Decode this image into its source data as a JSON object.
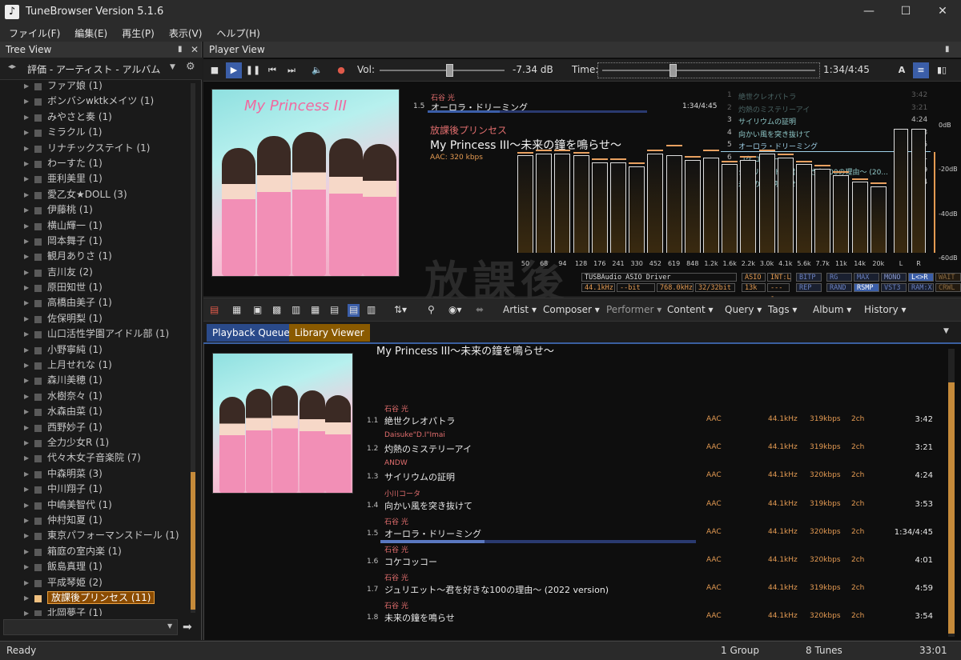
{
  "window": {
    "title": "TuneBrowser Version 5.1.6",
    "controls": [
      "—",
      "☐",
      "✕"
    ]
  },
  "menu": [
    "ファイル(F)",
    "編集(E)",
    "再生(P)",
    "表示(V)",
    "ヘルプ(H)"
  ],
  "tree_view": {
    "title": "Tree View",
    "hierarchy": "評価 - アーティスト - アルバム",
    "items": [
      "ファア娘 (1)",
      "ボンバシwktkメイツ (1)",
      "みやさと奏 (1)",
      "ミラクル (1)",
      "リナチックステイト (1)",
      "わーすた (1)",
      "亜利美里 (1)",
      "愛乙女★DOLL (3)",
      "伊藤桃 (1)",
      "横山輝一 (1)",
      "岡本舞子 (1)",
      "観月ありさ (1)",
      "吉川友 (2)",
      "原田知世 (1)",
      "高橋由美子 (1)",
      "佐保明梨 (1)",
      "山口活性学園アイドル部 (1)",
      "小野寧純 (1)",
      "上月せれな (1)",
      "森川美穂 (1)",
      "水樹奈々 (1)",
      "水森由菜 (1)",
      "西野妙子 (1)",
      "全力少女R (1)",
      "代々木女子音楽院 (7)",
      "中森明菜 (3)",
      "中川翔子 (1)",
      "中嶋美智代 (1)",
      "仲村知夏 (1)",
      "東京パフォーマンスドール (1)",
      "箱庭の室内楽 (1)",
      "飯島真理 (1)",
      "平成琴姫 (2)",
      "放課後プリンセス (11)",
      "北岡夢子 (1)"
    ],
    "selected_index": 33
  },
  "player": {
    "title": "Player View",
    "vol_label": "Vol:",
    "vol_value": "-7.34 dB",
    "vol_level": 0.56,
    "time_label": "Time:",
    "time_value": "1:34/4:45",
    "time_progress": 0.33,
    "now": {
      "track_no": "1.5",
      "artist": "石谷 光",
      "title": "オーロラ・ドリーミング",
      "elapsed": "1:34/4:45",
      "album_artist": "放課後プリンセス",
      "album": "My Princess III〜未来の鐘を鳴らせ〜",
      "codec": "AAC: 320 kbps"
    },
    "mini_list": [
      {
        "n": "1",
        "t": "絶世クレオパトラ",
        "d": "3:42"
      },
      {
        "n": "2",
        "t": "灼熱のミステリーアイ",
        "d": "3:21"
      },
      {
        "n": "3",
        "t": "サイリウムの証明",
        "d": "4:24"
      },
      {
        "n": "4",
        "t": "向かい風を突き抜けて",
        "d": "3:53"
      },
      {
        "n": "5",
        "t": "オーロラ・ドリーミング",
        "d": "4:45"
      },
      {
        "n": "6",
        "t": "コケコッコー",
        "d": "4:01"
      },
      {
        "n": "7",
        "t": "ジュリエット〜君を好きな100の理由〜 (20...",
        "d": "4:59"
      },
      {
        "n": "8",
        "t": "未来の鐘を鳴らせ",
        "d": "3:54"
      }
    ],
    "watermark": "放課後"
  },
  "spectrum": {
    "freqs": [
      "50",
      "68",
      "94",
      "128",
      "176",
      "241",
      "330",
      "452",
      "619",
      "848",
      "1.2k",
      "1.6k",
      "2.2k",
      "3.0k",
      "4.1k",
      "5.6k",
      "7.7k",
      "11k",
      "14k",
      "20k"
    ],
    "levels_db": [
      -16,
      -15,
      -15,
      -16,
      -19,
      -19,
      -21,
      -15,
      -16,
      -18,
      -17,
      -20,
      -18,
      -15,
      -17,
      -20,
      -22,
      -25,
      -28,
      -30
    ],
    "peaks_db": [
      -15,
      -14,
      -14,
      -15,
      -18,
      -18,
      -20,
      -14,
      -12,
      -17,
      -14,
      -19,
      -17,
      -14,
      -16,
      -19,
      -21,
      -24,
      -27,
      -29
    ],
    "channels": [
      "L",
      "R"
    ],
    "channel_levels_db": [
      -4,
      -4
    ],
    "db_ticks": [
      "0dB",
      "-20dB",
      "-40dB",
      "-60dB"
    ],
    "range_db": [
      -60,
      0
    ]
  },
  "device": {
    "driver": "TUSBAudio ASIO Driver",
    "rate": "44.1kHz",
    "bits": "--bit",
    "out_rate": "768.0kHz",
    "out_bits": "32/32bit",
    "buf1": "13k",
    "buf2": "----",
    "flags_row1": [
      "ASIO",
      "INT:L",
      "BITP",
      "RG",
      "MAX",
      "MONO",
      "L<>R",
      "WAIT"
    ],
    "flags_row2": [
      "REP",
      "RAND",
      "RSMP",
      "VST3",
      "RAM:X",
      "CRWL"
    ]
  },
  "toolbar": {
    "menus": [
      "Artist ▾",
      "Composer ▾",
      "Performer ▾",
      "Content ▾",
      "Query ▾",
      "Tags ▾",
      "Album ▾",
      "History ▾"
    ]
  },
  "tabs": [
    "Playback Queue",
    "Library Viewer"
  ],
  "queue": {
    "album_title": "My Princess III〜未来の鐘を鳴らせ〜",
    "tracks": [
      {
        "n": "1.1",
        "artist": "石谷 光",
        "title": "絶世クレオパトラ",
        "codec": "AAC",
        "rate": "44.1kHz",
        "kbps": "319kbps",
        "ch": "2ch",
        "dur": "3:42"
      },
      {
        "n": "1.2",
        "artist": "Daisuke\"D.I\"Imai",
        "title": "灼熱のミステリーアイ",
        "codec": "AAC",
        "rate": "44.1kHz",
        "kbps": "319kbps",
        "ch": "2ch",
        "dur": "3:21"
      },
      {
        "n": "1.3",
        "artist": "ANDW",
        "title": "サイリウムの証明",
        "codec": "AAC",
        "rate": "44.1kHz",
        "kbps": "320kbps",
        "ch": "2ch",
        "dur": "4:24"
      },
      {
        "n": "1.4",
        "artist": "小川コータ",
        "title": "向かい風を突き抜けて",
        "codec": "AAC",
        "rate": "44.1kHz",
        "kbps": "319kbps",
        "ch": "2ch",
        "dur": "3:53"
      },
      {
        "n": "1.5",
        "artist": "石谷 光",
        "title": "オーロラ・ドリーミング",
        "codec": "AAC",
        "rate": "44.1kHz",
        "kbps": "320kbps",
        "ch": "2ch",
        "dur": "1:34/4:45"
      },
      {
        "n": "1.6",
        "artist": "石谷 光",
        "title": "コケコッコー",
        "codec": "AAC",
        "rate": "44.1kHz",
        "kbps": "320kbps",
        "ch": "2ch",
        "dur": "4:01"
      },
      {
        "n": "1.7",
        "artist": "石谷 光",
        "title": "ジュリエット〜君を好きな100の理由〜 (2022 version)",
        "codec": "AAC",
        "rate": "44.1kHz",
        "kbps": "319kbps",
        "ch": "2ch",
        "dur": "4:59"
      },
      {
        "n": "1.8",
        "artist": "石谷 光",
        "title": "未来の鐘を鳴らせ",
        "codec": "AAC",
        "rate": "44.1kHz",
        "kbps": "320kbps",
        "ch": "2ch",
        "dur": "3:54"
      }
    ],
    "playing_index": 4,
    "playing_progress": 0.33
  },
  "status": {
    "left": "Ready",
    "groups": "1 Group",
    "tunes": "8 Tunes",
    "total": "33:01"
  }
}
